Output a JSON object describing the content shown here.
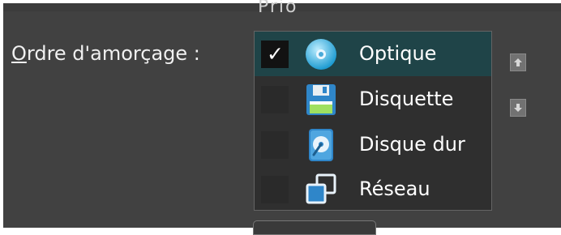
{
  "window": {
    "top_text": "Prio"
  },
  "boot_order": {
    "label": "Ordre d'amorçage :",
    "label_mnemonic": "O",
    "label_rest": "rdre d'amorçage :",
    "items": [
      {
        "label": "Optique",
        "icon": "optical-disc-icon",
        "checked": true,
        "selected": true
      },
      {
        "label": "Disquette",
        "icon": "floppy-disk-icon",
        "checked": false,
        "selected": false
      },
      {
        "label": "Disque dur",
        "icon": "hard-disk-icon",
        "checked": false,
        "selected": false
      },
      {
        "label": "Réseau",
        "icon": "network-icon",
        "checked": false,
        "selected": false
      }
    ],
    "move_up_icon": "arrow-up-icon",
    "move_down_icon": "arrow-down-icon"
  },
  "colors": {
    "panel_bg": "#414141",
    "list_bg": "#2f2f2f",
    "selected_row": "#1f4448",
    "text": "#ffffff"
  }
}
